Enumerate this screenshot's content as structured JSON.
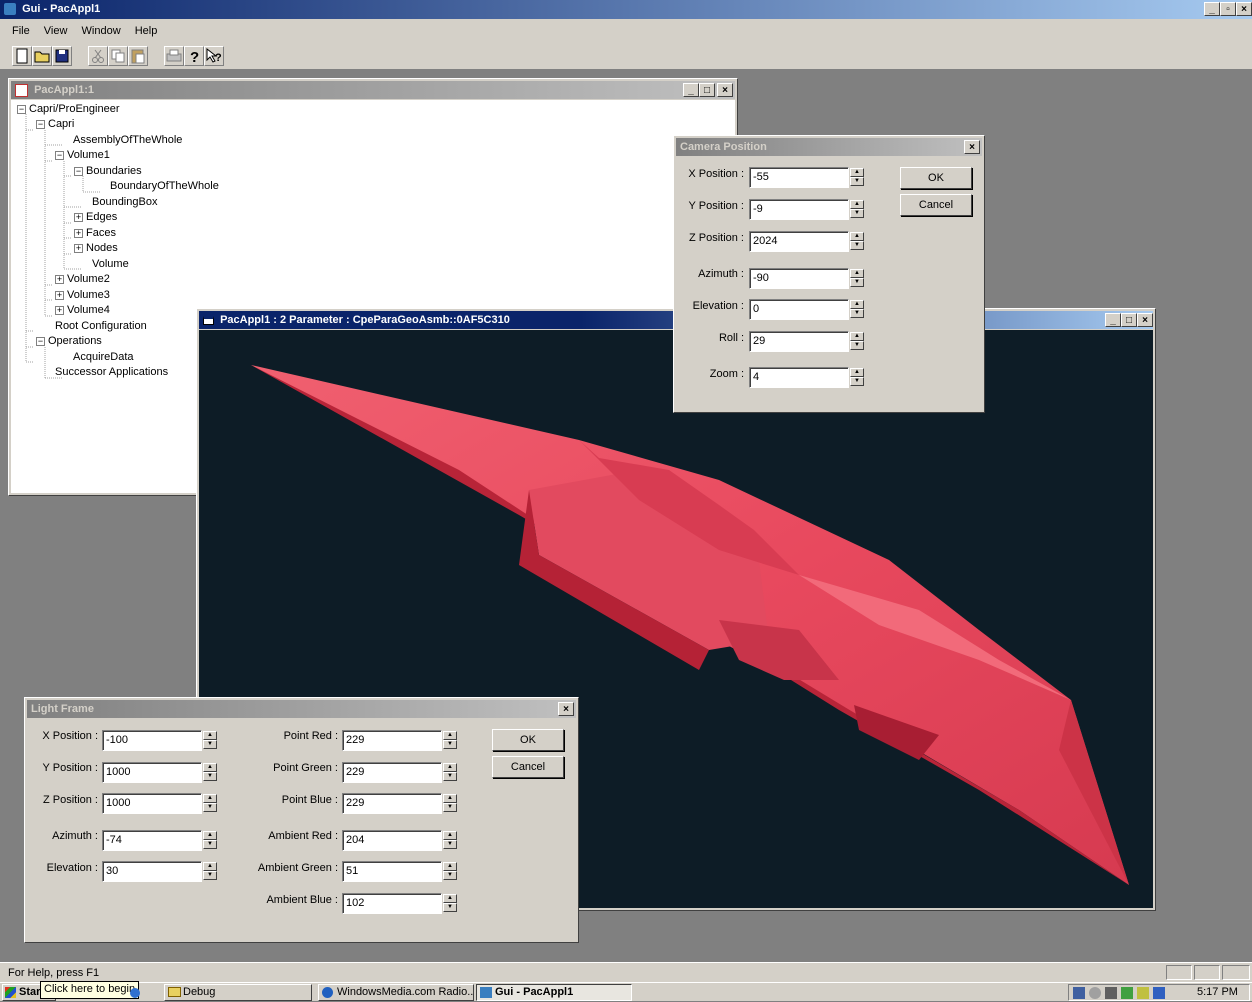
{
  "app": {
    "title": "Gui - PacAppl1",
    "menu": [
      "File",
      "View",
      "Window",
      "Help"
    ]
  },
  "colors": {
    "active_title": "#0a246a",
    "viewport_bg": "#0d1c26",
    "model": "#e8495e"
  },
  "tree_window": {
    "title": "PacAppl1:1",
    "nodes": [
      "Capri/ProEngineer",
      "Capri",
      "AssemblyOfTheWhole",
      "Volume1",
      "Boundaries",
      "BoundaryOfTheWhole",
      "BoundingBox",
      "Edges",
      "Faces",
      "Nodes",
      "Volume",
      "Volume2",
      "Volume3",
      "Volume4",
      "Root Configuration",
      "Operations",
      "AcquireData",
      "Successor Applications"
    ]
  },
  "viewer_window": {
    "title": "PacAppl1 : 2  Parameter : CpeParaGeoAsmb::0AF5C310"
  },
  "camera_dialog": {
    "title": "Camera Position",
    "fields": [
      {
        "label": "X Position :",
        "value": "-55"
      },
      {
        "label": "Y Position :",
        "value": "-9"
      },
      {
        "label": "Z Position :",
        "value": "2024"
      },
      {
        "label": "Azimuth :",
        "value": "-90"
      },
      {
        "label": "Elevation :",
        "value": "0"
      },
      {
        "label": "Roll :",
        "value": "29"
      },
      {
        "label": "Zoom :",
        "value": "4"
      }
    ],
    "ok": "OK",
    "cancel": "Cancel"
  },
  "light_dialog": {
    "title": "Light Frame",
    "left_fields": [
      {
        "label": "X Position :",
        "value": "-100"
      },
      {
        "label": "Y Position :",
        "value": "1000"
      },
      {
        "label": "Z Position :",
        "value": "1000"
      },
      {
        "label": "Azimuth :",
        "value": "-74"
      },
      {
        "label": "Elevation :",
        "value": "30"
      }
    ],
    "right_fields": [
      {
        "label": "Point Red :",
        "value": "229"
      },
      {
        "label": "Point Green :",
        "value": "229"
      },
      {
        "label": "Point Blue :",
        "value": "229"
      },
      {
        "label": "Ambient Red :",
        "value": "204"
      },
      {
        "label": "Ambient Green :",
        "value": "51"
      },
      {
        "label": "Ambient Blue :",
        "value": "102"
      }
    ],
    "ok": "OK",
    "cancel": "Cancel"
  },
  "status_bar": {
    "text": "For Help, press F1"
  },
  "taskbar": {
    "start": "Start",
    "tooltip": "Click here to begin",
    "tasks": [
      "Debug",
      "WindowsMedia.com Radio...",
      "Gui - PacAppl1"
    ],
    "clock": "5:17 PM"
  }
}
